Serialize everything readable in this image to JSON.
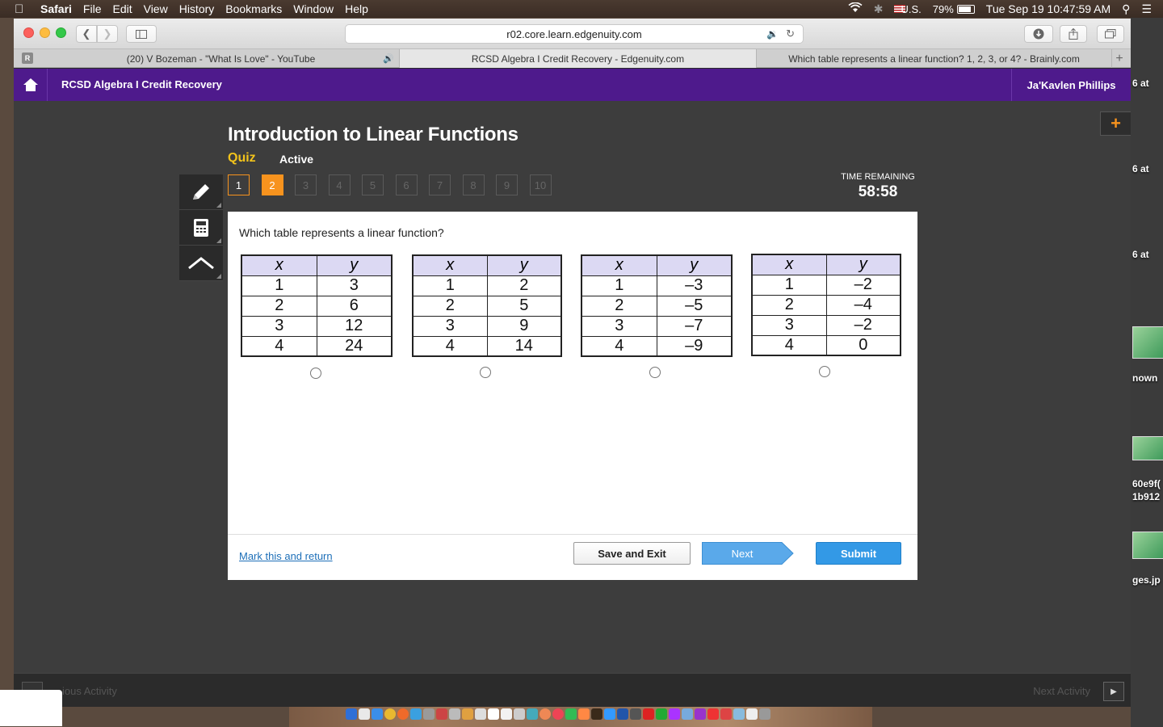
{
  "menubar": {
    "app": "Safari",
    "items": [
      "File",
      "Edit",
      "View",
      "History",
      "Bookmarks",
      "Window",
      "Help"
    ],
    "input_source": "U.S.",
    "battery": "79%",
    "clock": "Tue Sep 19  10:47:59 AM"
  },
  "browser": {
    "url": "r02.core.learn.edgenuity.com",
    "tabs": [
      {
        "label": "(20) V Bozeman - \"What Is Love\" - YouTube"
      },
      {
        "label": "RCSD Algebra I Credit Recovery - Edgenuity.com"
      },
      {
        "label": "Which table represents a linear function? 1, 2, 3, or 4? - Brainly.com"
      }
    ],
    "r_badge": "R",
    "new_tab": "+"
  },
  "app": {
    "course": "RCSD Algebra I Credit Recovery",
    "user": "Ja'Kavlen Phillips"
  },
  "quiz": {
    "title": "Introduction to Linear Functions",
    "type": "Quiz",
    "status": "Active",
    "questions": [
      "1",
      "2",
      "3",
      "4",
      "5",
      "6",
      "7",
      "8",
      "9",
      "10"
    ],
    "current": 2,
    "time_label": "TIME REMAINING",
    "time": "58:58",
    "prompt": "Which table represents a linear function?",
    "tables": [
      {
        "headers": [
          "x",
          "y"
        ],
        "rows": [
          [
            "1",
            "3"
          ],
          [
            "2",
            "6"
          ],
          [
            "3",
            "12"
          ],
          [
            "4",
            "24"
          ]
        ]
      },
      {
        "headers": [
          "x",
          "y"
        ],
        "rows": [
          [
            "1",
            "2"
          ],
          [
            "2",
            "5"
          ],
          [
            "3",
            "9"
          ],
          [
            "4",
            "14"
          ]
        ]
      },
      {
        "headers": [
          "x",
          "y"
        ],
        "rows": [
          [
            "1",
            "–3"
          ],
          [
            "2",
            "–5"
          ],
          [
            "3",
            "–7"
          ],
          [
            "4",
            "–9"
          ]
        ]
      },
      {
        "headers": [
          "x",
          "y"
        ],
        "rows": [
          [
            "1",
            "–2"
          ],
          [
            "2",
            "–4"
          ],
          [
            "3",
            "–2"
          ],
          [
            "4",
            "0"
          ]
        ]
      }
    ],
    "mark_link": "Mark this and return",
    "save_exit": "Save and Exit",
    "next": "Next",
    "submit": "Submit"
  },
  "footer": {
    "prev": "ious Activity",
    "next": "Next Activity"
  },
  "desktop_labels": [
    "6 at",
    "6 at",
    "6 at",
    "nown",
    "60e9f(",
    "1b912",
    "ges.jp"
  ],
  "colors": {
    "header_purple": "#4e1a8c",
    "accent_orange": "#f7931e",
    "quiz_yellow": "#f2c31b",
    "submit_blue": "#3399e6",
    "next_blue": "#5aa9ea"
  }
}
